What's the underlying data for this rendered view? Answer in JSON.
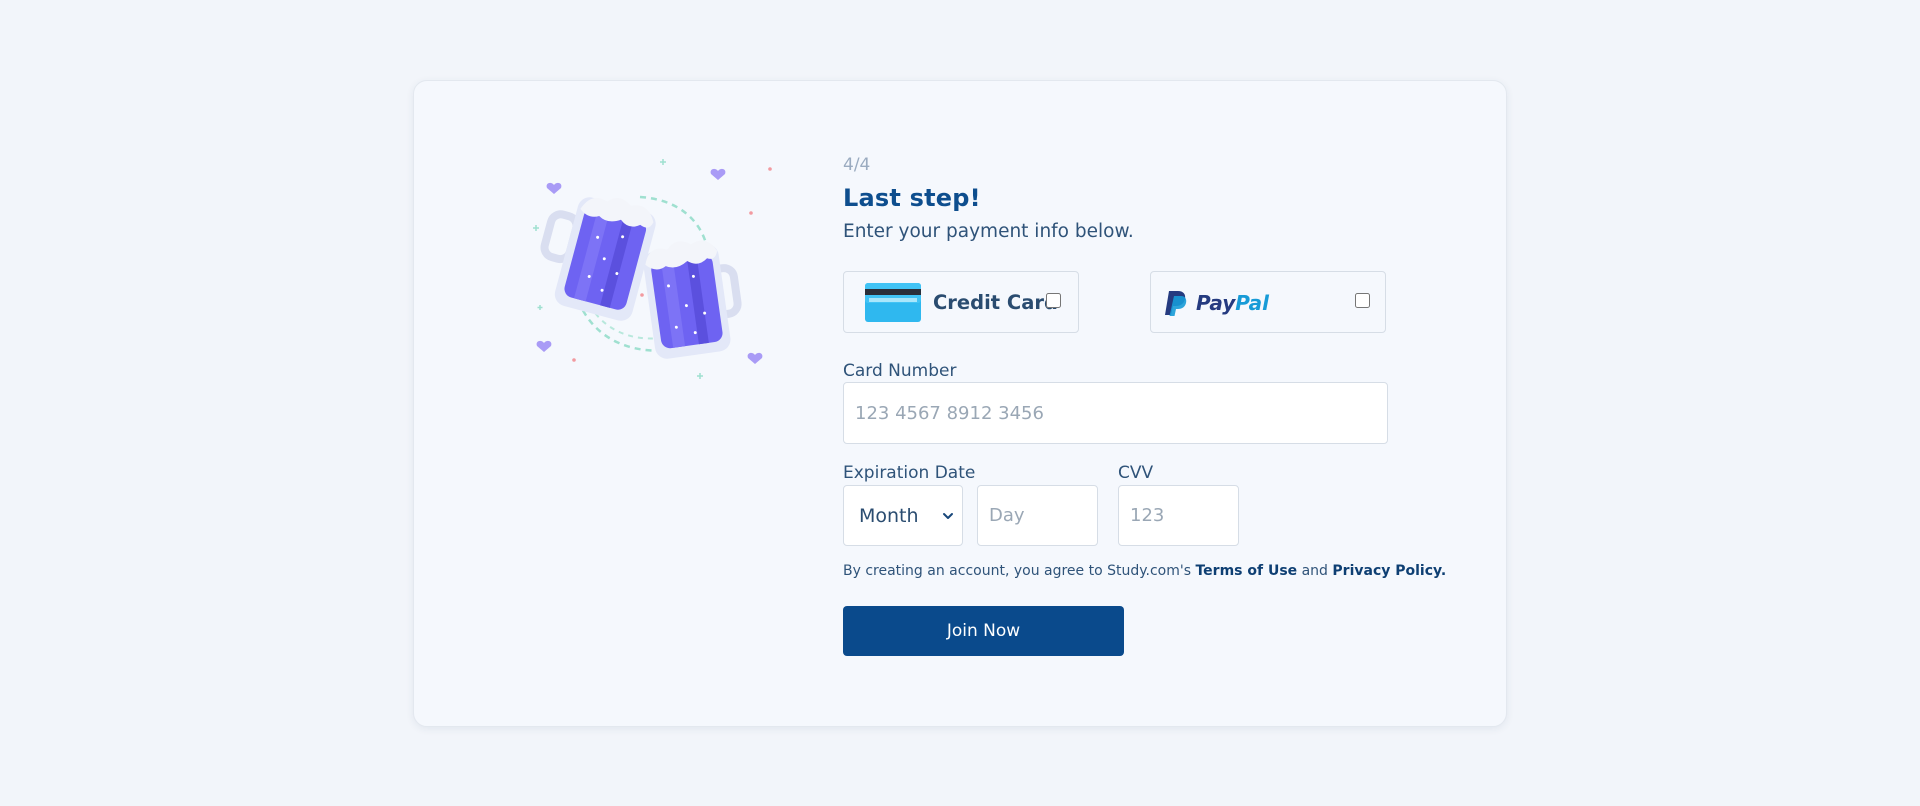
{
  "step": "4/4",
  "title": "Last step!",
  "subtitle": "Enter your payment info below.",
  "payment_options": {
    "credit_card": {
      "label": "Credit Card",
      "icon": "credit-card-icon",
      "checked": false
    },
    "paypal": {
      "label_pay": "Pay",
      "label_pal": "Pal",
      "icon": "paypal-logo-icon",
      "checked": false
    }
  },
  "card_number": {
    "label": "Card Number",
    "placeholder": "123 4567 8912 3456",
    "value": ""
  },
  "expiration": {
    "label": "Expiration Date",
    "month_selected": "Month",
    "day_placeholder": "Day"
  },
  "cvv": {
    "label": "CVV",
    "placeholder": "123"
  },
  "terms": {
    "prefix": "By creating an account, you agree to Study.com's ",
    "terms_link": "Terms of Use",
    "and": " and ",
    "privacy_link": "Privacy Policy."
  },
  "join_button": "Join Now",
  "colors": {
    "page_bg": "#f2f5fa",
    "card_bg": "#f5f8fd",
    "primary": "#0a4a8c",
    "heading": "#0e4e8e",
    "mug": "#6e63f2"
  }
}
